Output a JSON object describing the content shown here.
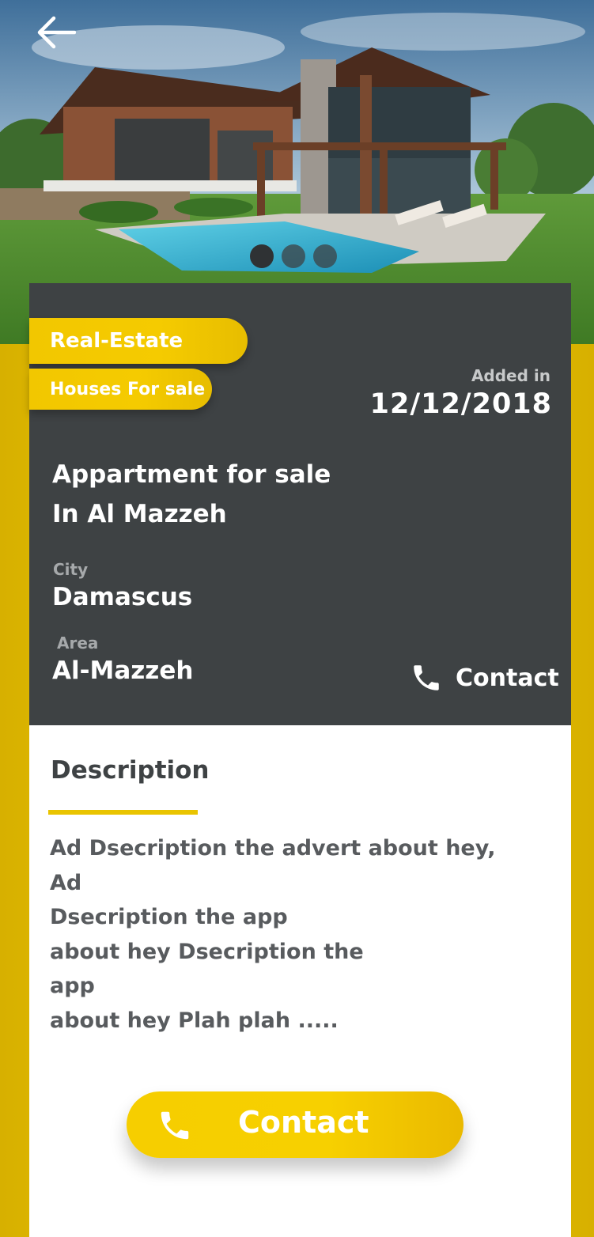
{
  "header": {
    "back_icon": "arrow-left-icon",
    "carousel": {
      "count": 3,
      "active_index": 0
    }
  },
  "tags": {
    "category": "Real-Estate",
    "subcategory": "Houses For sale"
  },
  "listing": {
    "added_label": "Added in",
    "added_date": "12/12/2018",
    "title_line1": "Appartment for sale",
    "title_line2": "In Al Mazzeh",
    "city_label": "City",
    "city_value": "Damascus",
    "area_label": "Area",
    "area_value": "Al-Mazzeh",
    "contact_label": "Contact",
    "contact_icon": "phone-icon"
  },
  "description": {
    "heading": "Description",
    "text": "Ad Dsecription the advert about hey, Ad\nDsecription the app\nabout hey Dsecription the\napp\nabout hey Plah plah ....."
  },
  "footer": {
    "contact_button_label": "Contact",
    "contact_button_icon": "phone-icon"
  },
  "colors": {
    "accent": "#F2C700",
    "card_dark": "#3E4244",
    "text_dark": "#3E4244",
    "text_gray": "#585B5E",
    "white": "#FFFFFF"
  }
}
